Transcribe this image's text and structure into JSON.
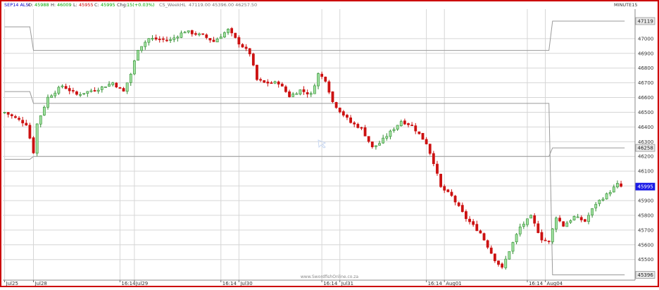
{
  "header": {
    "instrument": "SEP14 ALSI",
    "open_label": "O:",
    "open_value": "45988",
    "high_label": "H:",
    "high_value": "46009",
    "low_label": "L:",
    "low_value": "45955",
    "close_label": "C:",
    "close_value": "45995",
    "chg_label": "Chg:",
    "chg_value": "15(+0.03%)",
    "indicator_name": "CS_WeekHL",
    "indicator_values": "47119.00   45396.00   46257.50",
    "timeframe": "MINUTE15"
  },
  "watermark": "www.SwordfishOnline.co.za",
  "colors": {
    "up": "#9fe09f",
    "up_border": "#2e8b2e",
    "down": "#cc1111",
    "frame": "#cc0000",
    "grid": "#d6d6d6",
    "indicator": "#9a9a9a",
    "current_price_tag": "#1a1ae6"
  },
  "chart_data": {
    "type": "candlestick",
    "ylim": [
      45360,
      47200
    ],
    "y_ticks": [
      45500,
      45600,
      45700,
      45800,
      45900,
      46000,
      46100,
      46200,
      46300,
      46400,
      46500,
      46600,
      46700,
      46800,
      46900,
      47000
    ],
    "x_labels": [
      {
        "bar": 0,
        "text": "Jul25"
      },
      {
        "bar": 8,
        "text": "Jul28"
      },
      {
        "bar": 32,
        "text": "16:14"
      },
      {
        "bar": 36,
        "text": "Jul29"
      },
      {
        "bar": 60,
        "text": "16:14"
      },
      {
        "bar": 65,
        "text": "Jul30"
      },
      {
        "bar": 88,
        "text": "16:14"
      },
      {
        "bar": 93,
        "text": "Jul31"
      },
      {
        "bar": 117,
        "text": "16:14"
      },
      {
        "bar": 122,
        "text": "Aug01"
      },
      {
        "bar": 145,
        "text": "16:14"
      },
      {
        "bar": 150,
        "text": "Aug04"
      }
    ],
    "price_tags": [
      {
        "value": 47119,
        "text": "47119",
        "kind": "high"
      },
      {
        "value": 46258,
        "text": "46258",
        "kind": "mid"
      },
      {
        "value": 45995,
        "text": "45995",
        "kind": "current"
      },
      {
        "value": 45396,
        "text": "45396",
        "kind": "low"
      }
    ],
    "weekly_hl": {
      "high": [
        [
          0,
          47080
        ],
        [
          7,
          47080
        ],
        [
          8,
          46920
        ],
        [
          151,
          46920
        ],
        [
          152,
          47119
        ],
        [
          172,
          47119
        ]
      ],
      "low": [
        [
          0,
          46640
        ],
        [
          7,
          46640
        ],
        [
          8,
          46560
        ],
        [
          151,
          46560
        ],
        [
          152,
          45396
        ],
        [
          172,
          45396
        ]
      ],
      "mid": [
        [
          0,
          46180
        ],
        [
          7,
          46180
        ],
        [
          8,
          46200
        ],
        [
          151,
          46200
        ],
        [
          152,
          46258
        ],
        [
          172,
          46258
        ]
      ]
    },
    "anchors": [
      [
        0,
        46500
      ],
      [
        6,
        46420
      ],
      [
        8,
        46230
      ],
      [
        9,
        46420
      ],
      [
        12,
        46600
      ],
      [
        16,
        46680
      ],
      [
        20,
        46620
      ],
      [
        26,
        46660
      ],
      [
        30,
        46700
      ],
      [
        33,
        46640
      ],
      [
        35,
        46760
      ],
      [
        37,
        46930
      ],
      [
        40,
        47000
      ],
      [
        46,
        46990
      ],
      [
        50,
        47050
      ],
      [
        55,
        47020
      ],
      [
        58,
        46980
      ],
      [
        62,
        47060
      ],
      [
        65,
        46970
      ],
      [
        68,
        46900
      ],
      [
        70,
        46720
      ],
      [
        72,
        46700
      ],
      [
        76,
        46700
      ],
      [
        79,
        46610
      ],
      [
        82,
        46650
      ],
      [
        85,
        46620
      ],
      [
        87,
        46760
      ],
      [
        89,
        46720
      ],
      [
        91,
        46570
      ],
      [
        93,
        46510
      ],
      [
        96,
        46430
      ],
      [
        99,
        46390
      ],
      [
        102,
        46260
      ],
      [
        104,
        46290
      ],
      [
        106,
        46340
      ],
      [
        110,
        46440
      ],
      [
        113,
        46410
      ],
      [
        117,
        46290
      ],
      [
        119,
        46160
      ],
      [
        121,
        45990
      ],
      [
        124,
        45930
      ],
      [
        128,
        45780
      ],
      [
        132,
        45680
      ],
      [
        136,
        45500
      ],
      [
        138,
        45440
      ],
      [
        140,
        45560
      ],
      [
        143,
        45720
      ],
      [
        146,
        45790
      ],
      [
        149,
        45640
      ],
      [
        151,
        45620
      ],
      [
        153,
        45790
      ],
      [
        155,
        45730
      ],
      [
        158,
        45790
      ],
      [
        161,
        45760
      ],
      [
        164,
        45880
      ],
      [
        167,
        45940
      ],
      [
        170,
        46010
      ],
      [
        171,
        45995
      ]
    ],
    "volatility": 15
  }
}
